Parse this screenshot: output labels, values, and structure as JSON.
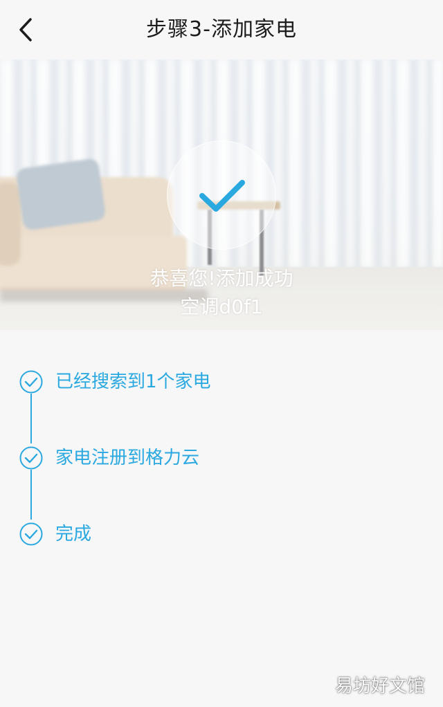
{
  "header": {
    "back_icon": "chevron-left-icon",
    "title": "步骤3-添加家电"
  },
  "hero": {
    "status_icon": "check-icon",
    "message": "恭喜您!添加成功",
    "device_name": "空调d0f1"
  },
  "steps": [
    {
      "icon": "check-circle-icon",
      "label": "已经搜索到1个家电",
      "done": true
    },
    {
      "icon": "check-circle-icon",
      "label": "家电注册到格力云",
      "done": true
    },
    {
      "icon": "check-circle-icon",
      "label": "完成",
      "done": true
    }
  ],
  "colors": {
    "accent": "#2aa8e0",
    "background": "#f7f7f8",
    "title_text": "#1c1c1c",
    "hero_text": "#ffffff"
  },
  "watermark": "易坊好文馆"
}
